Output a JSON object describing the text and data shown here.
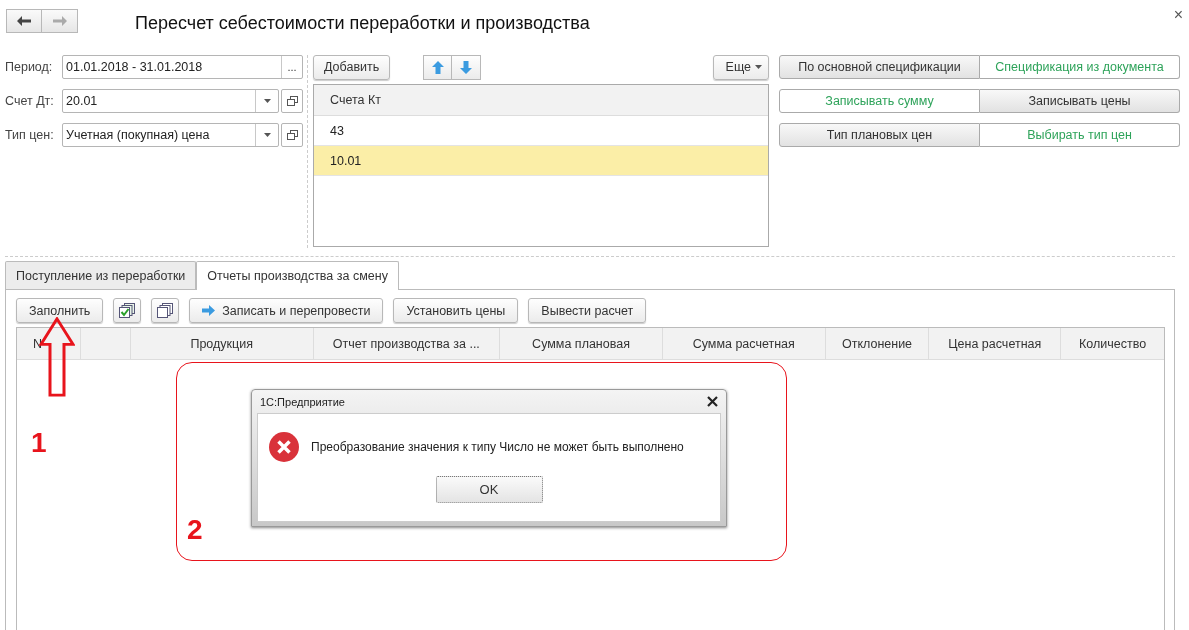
{
  "window": {
    "title": "Пересчет себестоимости переработки и производства",
    "close": "×"
  },
  "fields": [
    {
      "label": "Период:",
      "value": "01.01.2018 - 31.01.2018",
      "kind": "choice",
      "choice_button": "..."
    },
    {
      "label": "Счет Дт:",
      "value": "20.01",
      "kind": "dropdown"
    },
    {
      "label": "Тип цен:",
      "value": "Учетная (покупная) цена",
      "kind": "dropdown"
    }
  ],
  "accounts": {
    "add_button": "Добавить",
    "more_button": "Еще",
    "column": "Счета Кт",
    "rows": [
      {
        "value": "43",
        "selected": false
      },
      {
        "value": "10.01",
        "selected": true
      }
    ]
  },
  "toggles": [
    {
      "options": [
        {
          "label": "По основной спецификации",
          "selected": true
        },
        {
          "label": "Спецификация из документа",
          "selected": false
        }
      ]
    },
    {
      "options": [
        {
          "label": "Записывать сумму",
          "selected": false
        },
        {
          "label": "Записывать цены",
          "selected": true
        }
      ]
    },
    {
      "options": [
        {
          "label": "Тип плановых цен",
          "selected": true
        },
        {
          "label": "Выбирать тип цен",
          "selected": false
        }
      ]
    }
  ],
  "tabs": [
    {
      "label": "Поступление из переработки",
      "selected": false
    },
    {
      "label": "Отчеты производства за смену",
      "selected": true
    }
  ],
  "toolbar": [
    {
      "kind": "text",
      "label": "Заполнить"
    },
    {
      "kind": "check_icon"
    },
    {
      "kind": "copy_icon"
    },
    {
      "kind": "arrow_text",
      "label": "Записать и перепровести"
    },
    {
      "kind": "text",
      "label": "Установить цены"
    },
    {
      "kind": "text",
      "label": "Вывести расчет"
    }
  ],
  "table": {
    "columns": [
      "N",
      "",
      "Продукция",
      "Отчет производства за ...",
      "Сумма плановая",
      "Сумма расчетная",
      "Отклонение",
      "Цена расчетная",
      "Количество"
    ]
  },
  "dialog": {
    "title": "1С:Предприятие",
    "message": "Преобразование значения к типу Число не может быть выполнено",
    "button": "OK"
  },
  "annotations": [
    "1",
    "2"
  ]
}
